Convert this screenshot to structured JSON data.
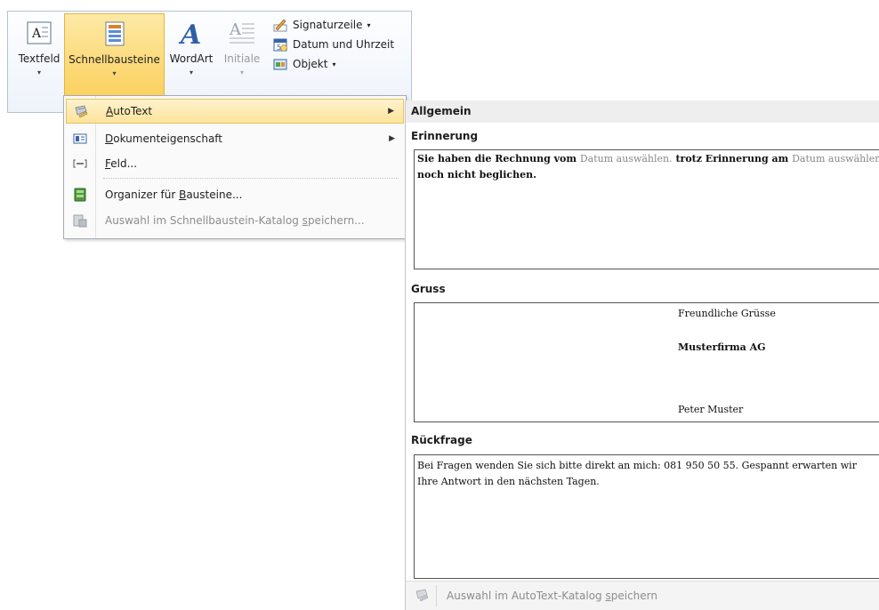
{
  "ribbon": {
    "textfeld": "Textfeld",
    "schnellbausteine": "Schnellbausteine",
    "wordart": "WordArt",
    "initiale": "Initiale",
    "signaturzeile": "Signaturzeile",
    "datum_uhrzeit": "Datum und Uhrzeit",
    "objekt": "Objekt",
    "dropdown_arrow": "▾",
    "small_arrow": "▾"
  },
  "menu": {
    "autotext": {
      "pre": "",
      "u": "A",
      "post": "utoText"
    },
    "dokumenteigenschaft": {
      "pre": "",
      "u": "D",
      "post": "okumenteigenschaft"
    },
    "feld": {
      "pre": "",
      "u": "F",
      "post": "eld..."
    },
    "organizer": {
      "pre": "Organizer für ",
      "u": "B",
      "post": "austeine..."
    },
    "auswahl": {
      "pre": "Auswahl im Schnellbaustein-Katalog ",
      "u": "s",
      "post": "peichern..."
    },
    "submenu_arrow": "▶"
  },
  "gallery": {
    "header": "Allgemein",
    "entries": [
      {
        "title": "Erinnerung",
        "line1_a": "Sie haben die Rechnung vom ",
        "line1_b": "Datum auswählen.",
        "line1_c": " trotz Erinnerung am ",
        "line1_d": "Datum auswählen.",
        "line2": "noch nicht beglichen."
      },
      {
        "title": "Gruss",
        "line1": "Freundliche Grüsse",
        "line2": "Musterfirma AG",
        "line3": "Peter Muster"
      },
      {
        "title": "Rückfrage",
        "line1": "Bei Fragen wenden Sie sich bitte direkt an mich: 081 950 50 55. Gespannt erwarten wir",
        "line2": "Ihre Antwort in den nächsten Tagen."
      }
    ],
    "footer": {
      "pre": "Auswahl im AutoText-Katalog ",
      "u": "s",
      "post": "peichern"
    }
  }
}
